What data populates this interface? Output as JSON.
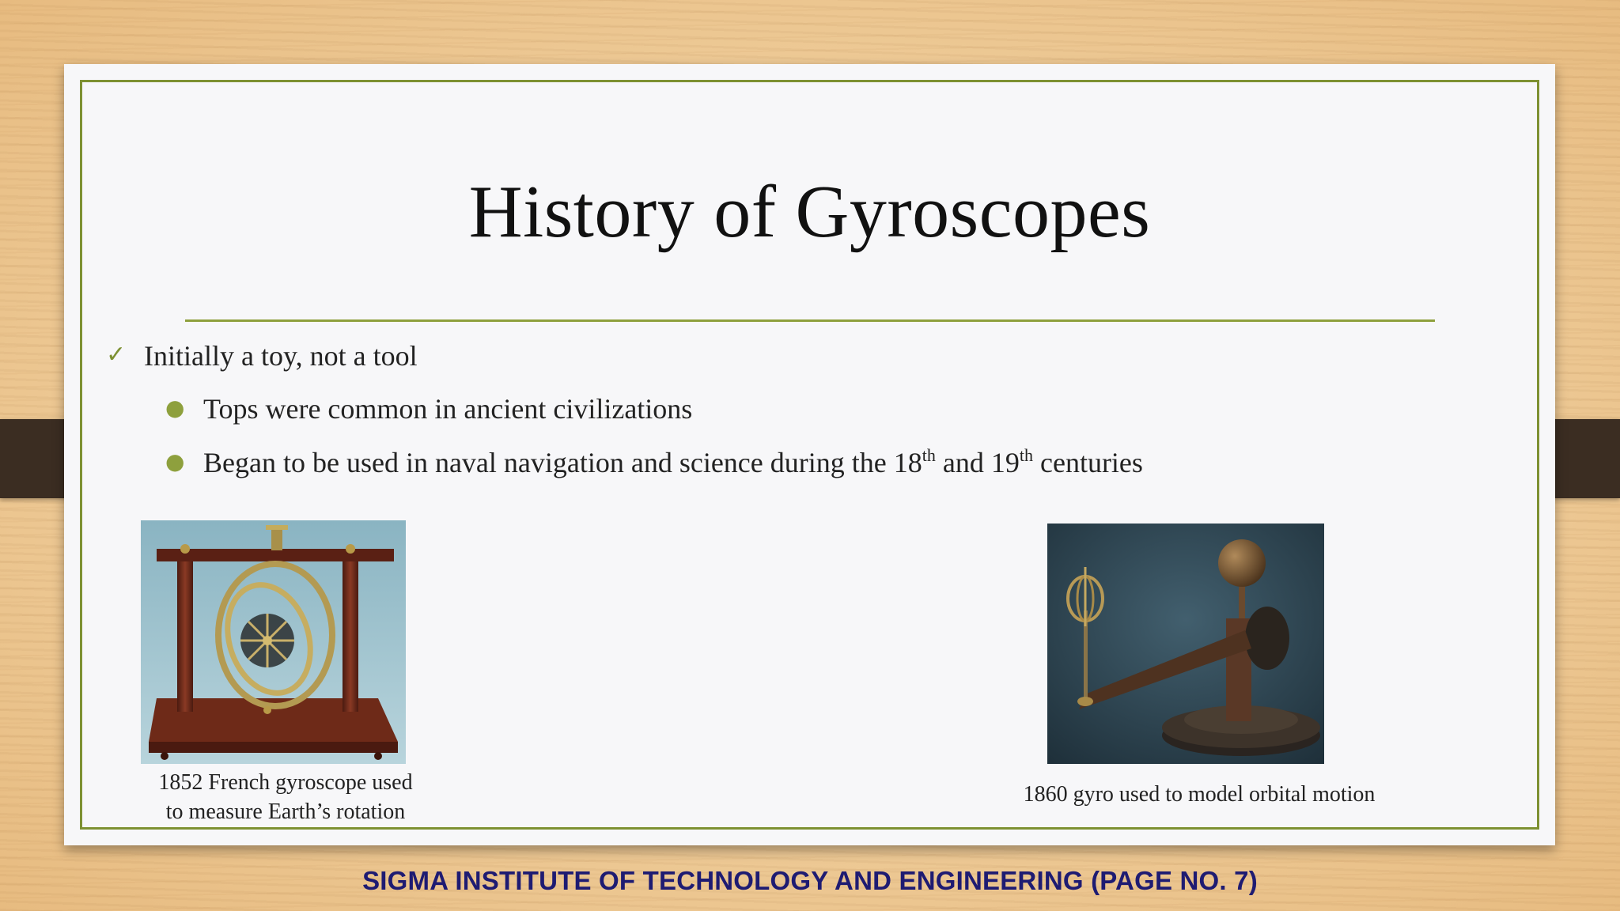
{
  "slide": {
    "title": "History of Gyroscopes",
    "main_bullet": "Initially a toy, not a tool",
    "sub_bullets": {
      "b1": "Tops were common in ancient civilizations",
      "b2_before": "Began to be used in naval navigation and science during the 18",
      "b2_sup1": "th",
      "b2_mid": " and 19",
      "b2_sup2": "th",
      "b2_after": " centuries"
    },
    "left_caption": {
      "line1": "1852 French gyroscope used",
      "line2": "to measure Earth’s rotation"
    },
    "right_caption": "1860 gyro used to model orbital motion"
  },
  "footer": "SIGMA INSTITUTE OF TECHNOLOGY AND ENGINEERING (PAGE NO. 7)",
  "colors": {
    "accent": "#7e9133",
    "footer_text": "#1e1b72",
    "background_wood": "#eecb98"
  },
  "icons": {
    "main_bullet": "checkmark-icon",
    "sub_bullet": "round-bullet-icon"
  }
}
